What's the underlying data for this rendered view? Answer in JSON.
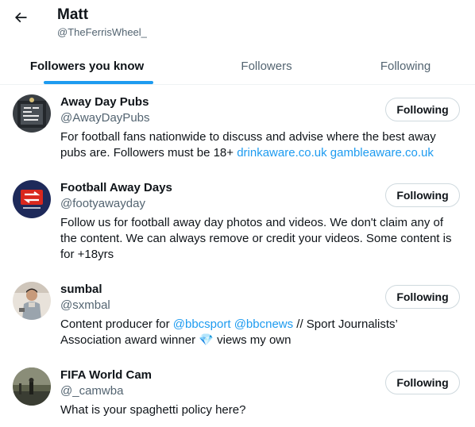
{
  "header": {
    "title": "Matt",
    "handle": "@TheFerrisWheel_"
  },
  "tabs": [
    {
      "label": "Followers you know",
      "active": true
    },
    {
      "label": "Followers",
      "active": false
    },
    {
      "label": "Following",
      "active": false
    }
  ],
  "colors": {
    "accent": "#1d9bf0",
    "text_primary": "#0f1419",
    "text_secondary": "#536471",
    "border": "#cfd9de"
  },
  "users": [
    {
      "name": "Away Day Pubs",
      "handle": "@AwayDayPubs",
      "button_label": "Following",
      "bio_text": "For football fans nationwide to discuss and advise where the best away pubs are. Followers must be 18+ ",
      "bio_link_1": "drinkaware.co.uk",
      "bio_link_2": "gambleaware.co.uk"
    },
    {
      "name": "Football Away Days",
      "handle": "@footyawayday",
      "button_label": "Following",
      "bio_text": "Follow us for football away day photos and videos. We don't claim any of the content. We can always remove or credit your videos. Some content is for +18yrs"
    },
    {
      "name": "sumbal",
      "handle": "@sxmbal",
      "button_label": "Following",
      "bio_prefix": "Content producer for ",
      "bio_link_1": "@bbcsport",
      "bio_link_2": "@bbcnews",
      "bio_suffix_1": " // Sport Journalists’ Association award winner ",
      "bio_emoji": "💎",
      "bio_suffix_2": " views my own"
    },
    {
      "name": "FIFA World Cam",
      "handle": "@_camwba",
      "button_label": "Following",
      "bio_text": "What is your spaghetti policy here?"
    }
  ]
}
